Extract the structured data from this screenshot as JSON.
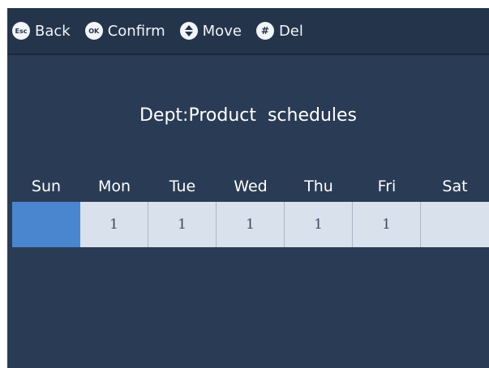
{
  "topbar": {
    "keys": [
      {
        "icon": "esc-key-icon",
        "badge": "Esc",
        "label": "Back"
      },
      {
        "icon": "ok-key-icon",
        "badge": "OK",
        "label": "Confirm"
      },
      {
        "icon": "updown-key-icon",
        "badge": "▲▼",
        "label": "Move"
      },
      {
        "icon": "hash-key-icon",
        "badge": "#",
        "label": "Del"
      }
    ]
  },
  "title": "Dept:Product  schedules",
  "schedule": {
    "days": [
      "Sun",
      "Mon",
      "Tue",
      "Wed",
      "Thu",
      "Fri",
      "Sat"
    ],
    "values": [
      "",
      "1",
      "1",
      "1",
      "1",
      "1",
      ""
    ],
    "selected_index": 0
  },
  "colors": {
    "background": "#2a3b55",
    "topbar": "#24344b",
    "cell": "#d9e1ec",
    "selected_cell": "#4a86cf"
  }
}
